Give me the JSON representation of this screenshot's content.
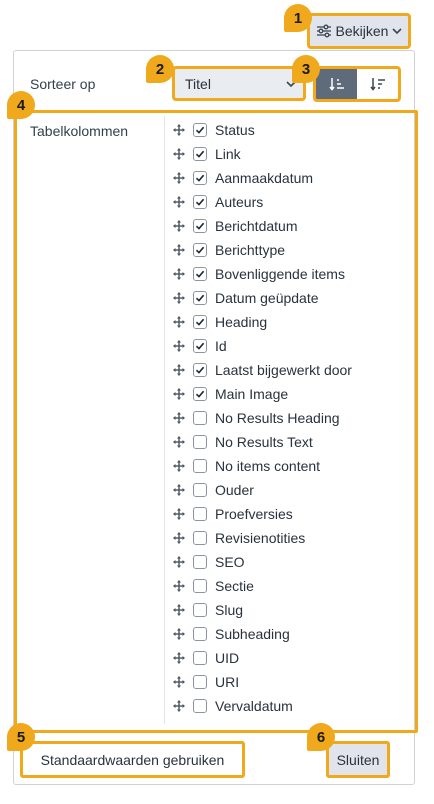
{
  "header": {
    "view_label": "Bekijken"
  },
  "sort": {
    "label": "Sorteer op",
    "selected": "Titel",
    "ascending_icon": "sort-ascending-icon",
    "descending_icon": "sort-descending-icon",
    "active_direction": "ascending"
  },
  "columns": {
    "label": "Tabelkolommen",
    "items": [
      {
        "label": "Status",
        "checked": true
      },
      {
        "label": "Link",
        "checked": true
      },
      {
        "label": "Aanmaakdatum",
        "checked": true
      },
      {
        "label": "Auteurs",
        "checked": true
      },
      {
        "label": "Berichtdatum",
        "checked": true
      },
      {
        "label": "Berichttype",
        "checked": true
      },
      {
        "label": "Bovenliggende items",
        "checked": true
      },
      {
        "label": "Datum geüpdate",
        "checked": true
      },
      {
        "label": "Heading",
        "checked": true
      },
      {
        "label": "Id",
        "checked": true
      },
      {
        "label": "Laatst bijgewerkt door",
        "checked": true
      },
      {
        "label": "Main Image",
        "checked": true
      },
      {
        "label": "No Results Heading",
        "checked": false
      },
      {
        "label": "No Results Text",
        "checked": false
      },
      {
        "label": "No items content",
        "checked": false
      },
      {
        "label": "Ouder",
        "checked": false
      },
      {
        "label": "Proefversies",
        "checked": false
      },
      {
        "label": "Revisienotities",
        "checked": false
      },
      {
        "label": "SEO",
        "checked": false
      },
      {
        "label": "Sectie",
        "checked": false
      },
      {
        "label": "Slug",
        "checked": false
      },
      {
        "label": "Subheading",
        "checked": false
      },
      {
        "label": "UID",
        "checked": false
      },
      {
        "label": "URI",
        "checked": false
      },
      {
        "label": "Vervaldatum",
        "checked": false
      }
    ]
  },
  "footer": {
    "defaults_label": "Standaardwaarden gebruiken",
    "close_label": "Sluiten"
  },
  "badges": [
    "1",
    "2",
    "3",
    "4",
    "5",
    "6"
  ],
  "colors": {
    "highlight": "#f0a81c",
    "active_sort": "#5f6b7b",
    "button_bg": "#e1e4ea"
  }
}
